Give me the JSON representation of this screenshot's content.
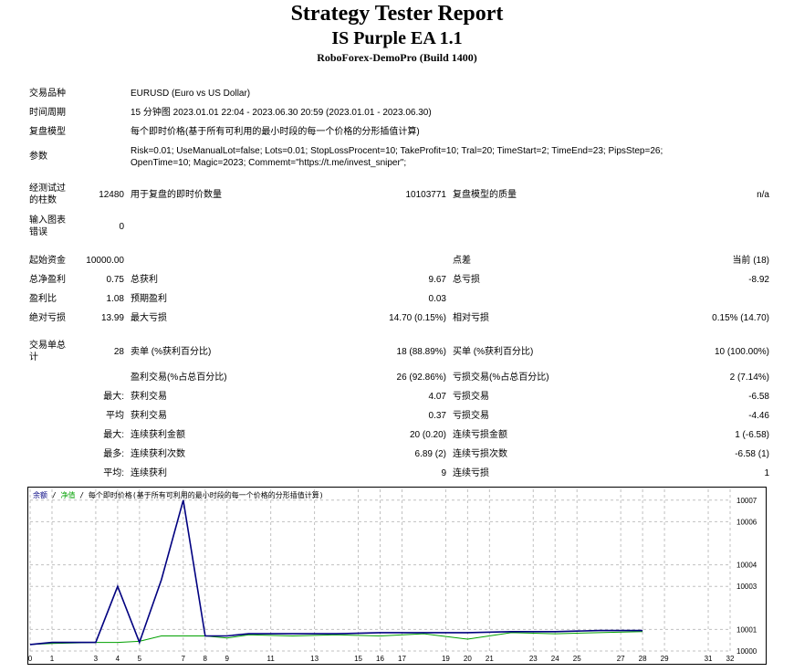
{
  "header": {
    "title": "Strategy Tester Report",
    "subtitle": "IS Purple EA 1.1",
    "build": "RoboForex-DemoPro (Build 1400)"
  },
  "settings": {
    "symbol_label": "交易品种",
    "symbol_value": "EURUSD (Euro vs US Dollar)",
    "period_label": "时间周期",
    "period_value": "15 分钟图 2023.01.01 22:04 - 2023.06.30 20:59 (2023.01.01 - 2023.06.30)",
    "model_label": "复盘模型",
    "model_value": "每个即时价格(基于所有可利用的最小时段的每一个价格的分形插值计算)",
    "params_label": "参数",
    "params_line1": "Risk=0.01; UseManualLot=false; Lots=0.01; StopLossProcent=10; TakeProfit=10; Tral=20; TimeStart=2; TimeEnd=23; PipsStep=26;",
    "params_line2": "OpenTime=10; Magic=2023; Commemt=\"https://t.me/invest_sniper\";"
  },
  "quality": {
    "bars_label_1": "经测试过",
    "bars_label_2": "的柱数",
    "bars_value": "12480",
    "ticks_label": "用于复盘的即时价数量",
    "ticks_value": "10103771",
    "model_quality_label": "复盘模型的质量",
    "model_quality_value": "n/a",
    "mismatch_label_1": "输入图表",
    "mismatch_label_2": "错误",
    "mismatch_value": "0"
  },
  "results": {
    "deposit_label": "起始资金",
    "deposit_value": "10000.00",
    "spread_label": "点差",
    "spread_value": "当前 (18)",
    "net_profit_label": "总净盈利",
    "net_profit_value": "0.75",
    "gross_profit_label": "总获利",
    "gross_profit_value": "9.67",
    "gross_loss_label": "总亏损",
    "gross_loss_value": "-8.92",
    "profit_factor_label": "盈利比",
    "profit_factor_value": "1.08",
    "expected_payoff_label": "预期盈利",
    "expected_payoff_value": "0.03",
    "abs_dd_label": "绝对亏损",
    "abs_dd_value": "13.99",
    "max_dd_label": "最大亏损",
    "max_dd_value": "14.70 (0.15%)",
    "rel_dd_label": "相对亏损",
    "rel_dd_value": "0.15% (14.70)"
  },
  "trades": {
    "total_label_1": "交易单总",
    "total_label_2": "计",
    "total_value": "28",
    "short_label": "卖单 (%获利百分比)",
    "short_value": "18 (88.89%)",
    "long_label": "买单 (%获利百分比)",
    "long_value": "10 (100.00%)",
    "profit_trades_label": "盈利交易(%占总百分比)",
    "profit_trades_value": "26 (92.86%)",
    "loss_trades_label": "亏损交易(%占总百分比)",
    "loss_trades_value": "2 (7.14%)",
    "largest_prefix": "最大:",
    "largest_profit_label": "获利交易",
    "largest_profit_value": "4.07",
    "largest_loss_label": "亏损交易",
    "largest_loss_value": "-6.58",
    "average_prefix": "平均",
    "average_profit_label": "获利交易",
    "average_profit_value": "0.37",
    "average_loss_label": "亏损交易",
    "average_loss_value": "-4.46",
    "max_prefix": "最大:",
    "max_consec_wins_label": "连续获利金额",
    "max_consec_wins_value": "20 (0.20)",
    "max_consec_losses_label": "连续亏损金额",
    "max_consec_losses_value": "1 (-6.58)",
    "maximal_prefix": "最多:",
    "maximal_consec_profit_label": "连续获利次数",
    "maximal_consec_profit_value": "6.89 (2)",
    "maximal_consec_loss_label": "连续亏损次数",
    "maximal_consec_loss_value": "-6.58 (1)",
    "avg_prefix": "平均:",
    "avg_consec_wins_label": "连续获利",
    "avg_consec_wins_value": "9",
    "avg_consec_losses_label": "连续亏损",
    "avg_consec_losses_value": "1"
  },
  "chart_legend": {
    "balance": "余额",
    "sep1": " / ",
    "equity": "净值",
    "sep2": " / ",
    "model": "每个即时价格(基于所有可利用的最小时段的每一个价格的分形插值计算)"
  },
  "chart_data": {
    "type": "line",
    "colors": {
      "balance": "#000080",
      "equity": "#00a000",
      "grid": "#c0c0c0"
    },
    "x_ticks": [
      "0",
      "1",
      "3",
      "4",
      "5",
      "7",
      "8",
      "9",
      "11",
      "13",
      "15",
      "16",
      "17",
      "19",
      "20",
      "21",
      "23",
      "24",
      "25",
      "27",
      "28",
      "29",
      "31",
      "32"
    ],
    "y_ticks": [
      10000,
      10001,
      10003,
      10004,
      10006,
      10007
    ],
    "ylim": [
      10000,
      10007.5
    ],
    "x_range": [
      0,
      32
    ],
    "series": [
      {
        "name": "余额",
        "x": [
          0,
          1,
          3,
          4,
          5,
          6,
          7,
          8,
          9,
          10,
          12,
          14,
          16,
          18,
          20,
          22,
          24,
          26,
          28
        ],
        "y": [
          10000.3,
          10000.4,
          10000.4,
          10003.0,
          10000.4,
          10003.3,
          10007.0,
          10000.7,
          10000.7,
          10000.8,
          10000.8,
          10000.8,
          10000.85,
          10000.85,
          10000.85,
          10000.9,
          10000.9,
          10000.95,
          10000.95
        ]
      },
      {
        "name": "净值",
        "x": [
          0,
          1,
          3,
          4,
          5,
          6,
          7,
          8,
          9,
          10,
          12,
          14,
          16,
          18,
          20,
          22,
          24,
          26,
          28
        ],
        "y": [
          10000.3,
          10000.35,
          10000.4,
          10000.4,
          10000.45,
          10000.7,
          10000.7,
          10000.7,
          10000.6,
          10000.75,
          10000.7,
          10000.75,
          10000.7,
          10000.8,
          10000.55,
          10000.85,
          10000.8,
          10000.85,
          10000.9
        ]
      }
    ]
  }
}
